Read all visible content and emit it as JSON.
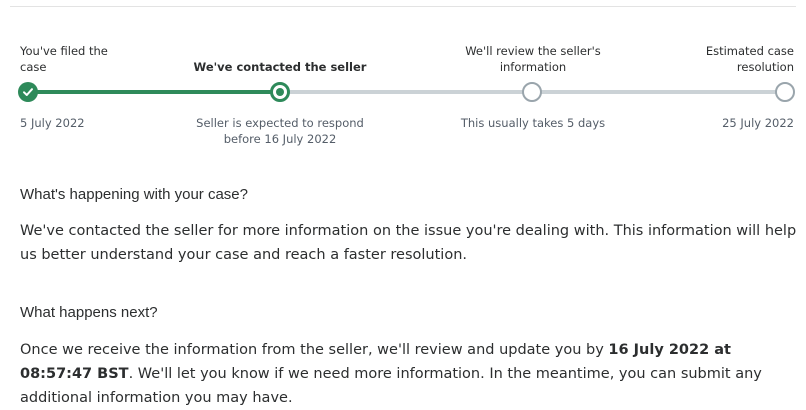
{
  "steps": [
    {
      "label": "You've filed the case",
      "date": "5 July 2022",
      "state": "complete"
    },
    {
      "label": "We've contacted the seller",
      "date": "Seller is expected to respond before 16 July 2022",
      "state": "current"
    },
    {
      "label": "We'll review the seller's information",
      "date": "This usually takes 5 days",
      "state": "pending"
    },
    {
      "label": "Estimated case resolution",
      "date": "25 July 2022",
      "state": "pending"
    }
  ],
  "section1": {
    "heading": "What's happening with your case?",
    "body": "We've contacted the seller for more information on the issue you're dealing with. This information will help us better understand your case and reach a faster resolution."
  },
  "section2": {
    "heading": "What happens next?",
    "body_prefix": "Once we receive the information from the seller, we'll review and update you by ",
    "deadline": "16 July 2022 at 08:57:47 BST",
    "body_suffix": ". We'll let you know if we need more information. In the meantime, you can submit any additional information you may have."
  },
  "colors": {
    "progress": "#2e8a5a",
    "track": "#cbd2d6",
    "pending_border": "#9aa5ac"
  },
  "icons": {
    "complete_step": "check-icon"
  }
}
